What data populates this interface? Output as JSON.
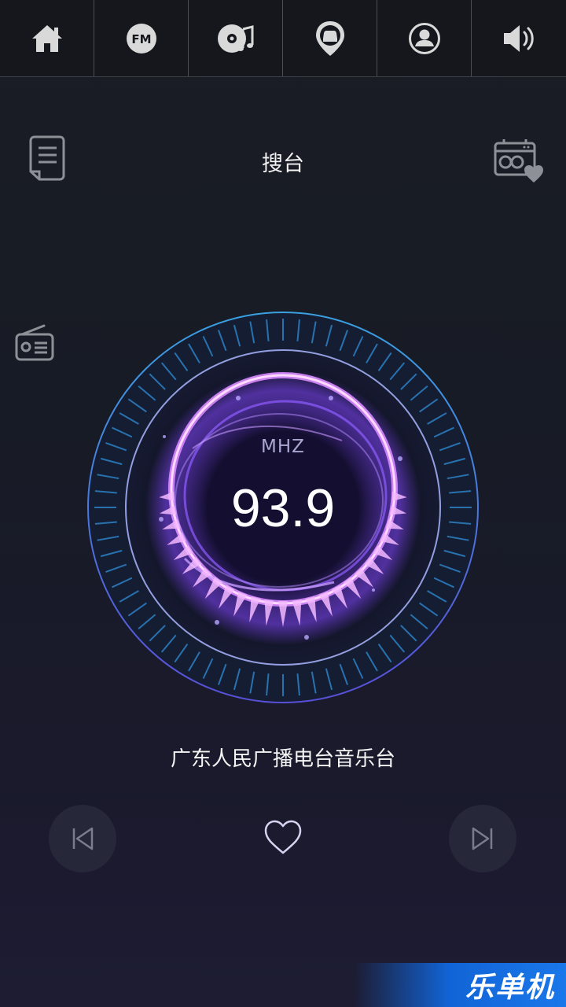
{
  "tabs": [
    {
      "name": "home-icon"
    },
    {
      "name": "fm-icon",
      "label": "FM"
    },
    {
      "name": "music-disc-icon"
    },
    {
      "name": "car-location-icon"
    },
    {
      "name": "user-icon"
    },
    {
      "name": "volume-icon"
    }
  ],
  "header": {
    "title": "搜台",
    "left_icon": "list-document-icon",
    "right_icon": "favorite-radio-icon"
  },
  "side": {
    "radio_icon": "radio-icon"
  },
  "tuner": {
    "unit": "MHZ",
    "frequency": "93.9",
    "station": "广东人民广播电台音乐台"
  },
  "controls": {
    "prev_icon": "skip-previous-icon",
    "favorite_icon": "heart-icon",
    "next_icon": "skip-next-icon"
  },
  "watermark": {
    "text": "乐单机"
  },
  "colors": {
    "accent_pink": "#f3a7ff",
    "accent_purple": "#8a5cff",
    "ring_blue": "#2f8fd9",
    "icon_gray": "#9a9ca3"
  }
}
